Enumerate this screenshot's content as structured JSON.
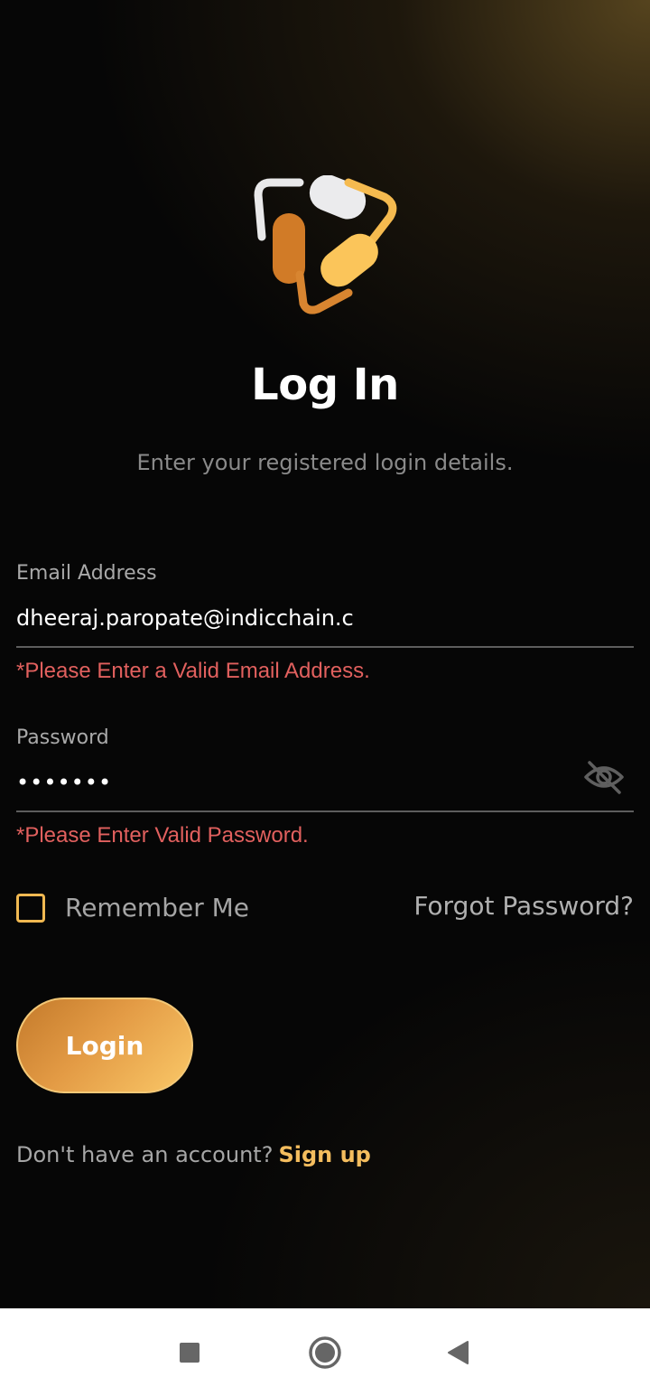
{
  "header": {
    "title": "Log In",
    "subtitle": "Enter your registered login details."
  },
  "email": {
    "label": "Email Address",
    "value": "dheeraj.paropate@indicchain.c",
    "error": "*Please Enter a Valid Email Address."
  },
  "password": {
    "label": "Password",
    "value": "•••••••",
    "error": "*Please Enter Valid Password.",
    "toggle_icon": "eye-off-icon"
  },
  "options": {
    "remember_label": "Remember Me",
    "remember_checked": false,
    "forgot_label": "Forgot Password?"
  },
  "actions": {
    "login_label": "Login"
  },
  "footer": {
    "prompt": "Don't have an account?",
    "signup_label": "Sign up"
  },
  "navbar": {
    "recents_icon": "square-icon",
    "home_icon": "circle-icon",
    "back_icon": "triangle-back-icon"
  },
  "colors": {
    "accent": "#f4bd5e",
    "error": "#e1605e",
    "button_start": "#c47a2b",
    "button_end": "#fac868"
  }
}
